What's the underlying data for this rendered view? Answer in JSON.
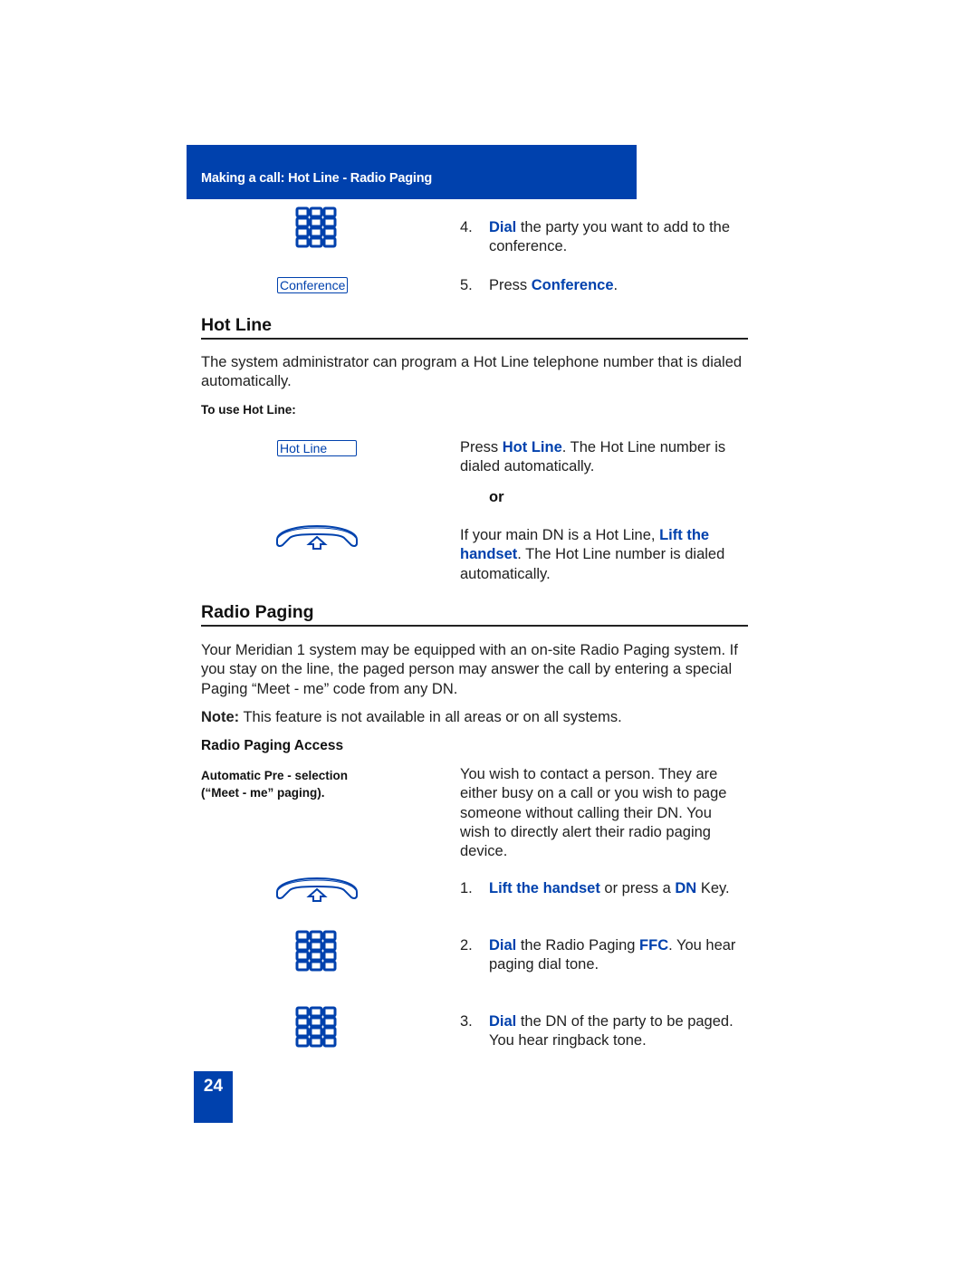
{
  "header": {
    "title": "Making a call: Hot Line - Radio Paging"
  },
  "colors": {
    "accent": "#0041ad",
    "text": "#1f1f1f",
    "background": "#ffffff"
  },
  "conference_steps": {
    "step4": {
      "number": "4.",
      "highlight": "Dial",
      "rest_line": " the party you want to add to the conference."
    },
    "step5": {
      "number": "5.",
      "prefix": "Press ",
      "highlight": "Conference",
      "suffix": "."
    },
    "conference_softkey": "Conference",
    "keypad_icon": "keypad-icon"
  },
  "hot_line": {
    "title": "Hot Line",
    "intro": "The system administrator can program a Hot Line telephone number that is dialed automatically.",
    "subheading": "To use Hot Line:",
    "softkey": "Hot Line",
    "option1": {
      "prefix": "Press ",
      "highlight": "Hot Line",
      "suffix": ". The Hot Line number is dialed automatically."
    },
    "or_label": "or",
    "option2": {
      "prefix": "If your main DN is a Hot Line, ",
      "highlight": "Lift the handset",
      "suffix": ". The Hot Line number is dialed automatically."
    },
    "handset_icon": "handset-lift-icon"
  },
  "radio_paging": {
    "title": "Radio Paging",
    "intro": "Your Meridian 1 system may be equipped with an on-site Radio Paging system. If you stay on the line, the paged person may answer the call by entering a special Paging “Meet - me” code from any DN.",
    "note_label": "Note:",
    "note_text": " This feature is not available in all areas or on all systems.",
    "access_heading": "Radio Paging Access",
    "access_label_line1": "Automatic Pre - selection",
    "access_label_line2": "(“Meet - me” paging).",
    "access_description": "You wish to contact a person. They are either busy on a call or you wish to page someone without calling their DN. You wish to directly alert their radio paging device.",
    "steps": [
      {
        "number": "1.",
        "parts": [
          {
            "t": "Lift the handset",
            "hl": true
          },
          {
            "t": " or press a ",
            "hl": false
          },
          {
            "t": "DN",
            "hl": true
          },
          {
            "t": " Key.",
            "hl": false
          }
        ]
      },
      {
        "number": "2.",
        "parts": [
          {
            "t": "Dial",
            "hl": true
          },
          {
            "t": " the Radio Paging ",
            "hl": false
          },
          {
            "t": "FFC",
            "hl": true
          },
          {
            "t": ". You hear paging dial tone.",
            "hl": false
          }
        ]
      },
      {
        "number": "3.",
        "parts": [
          {
            "t": "Dial",
            "hl": true
          },
          {
            "t": " the DN of the party to be paged. You hear ringback tone.",
            "hl": false
          }
        ]
      }
    ]
  },
  "page_number": "24"
}
